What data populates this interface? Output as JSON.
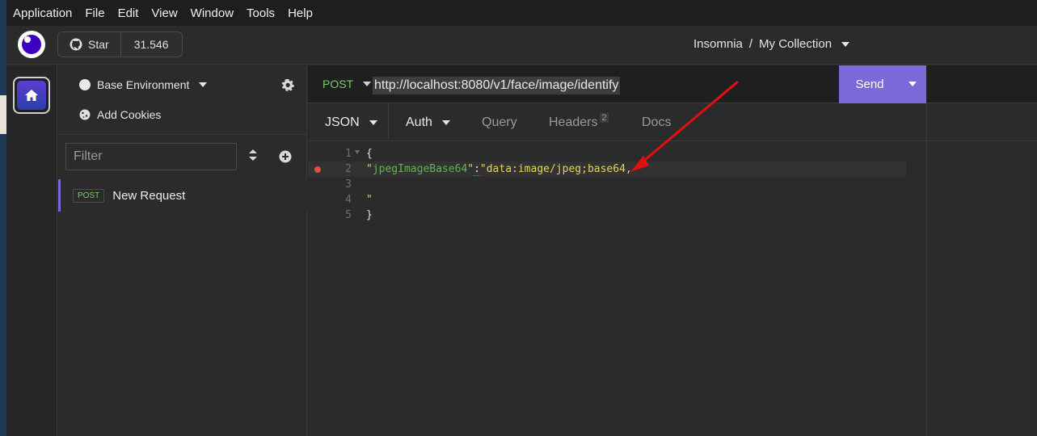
{
  "menubar": {
    "items": [
      "Application",
      "File",
      "Edit",
      "View",
      "Window",
      "Tools",
      "Help"
    ]
  },
  "header": {
    "star_label": "Star",
    "star_count": "31.546",
    "breadcrumb": {
      "workspace": "Insomnia",
      "separator": "/",
      "collection": "My Collection"
    }
  },
  "sidebar": {
    "environment": "Base Environment",
    "add_cookies": "Add Cookies",
    "filter_placeholder": "Filter",
    "requests": [
      {
        "method": "POST",
        "name": "New Request"
      }
    ]
  },
  "request": {
    "method": "POST",
    "url": "http://localhost:8080/v1/face/image/identify",
    "send_label": "Send",
    "tabs": {
      "body": "JSON",
      "auth": "Auth",
      "query": "Query",
      "headers": "Headers",
      "headers_count": "2",
      "docs": "Docs"
    }
  },
  "editor": {
    "line_numbers": [
      "1",
      "2",
      "3",
      "4",
      "5"
    ],
    "line1": "{",
    "line2_quote_open": "\"",
    "line2_key": "jpegImageBase64",
    "line2_quote_close": "\"",
    "line2_colon": ":",
    "line2_value": "\"data:image/jpeg;base64,",
    "line4": "\"",
    "line5": "}"
  },
  "colors": {
    "accent": "#7a69d6",
    "method_post": "#7dc86a",
    "annotation_arrow": "#e01010"
  },
  "icons": [
    "github-icon",
    "gear-icon",
    "cookie-icon",
    "sort-icon",
    "add-icon",
    "home-icon"
  ]
}
